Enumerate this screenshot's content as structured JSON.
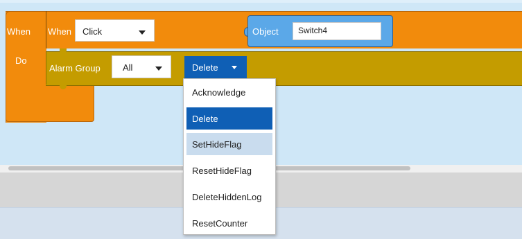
{
  "event_block": {
    "when_label": "When",
    "do_label": "Do",
    "inner_when_label": "When",
    "trigger_value": "Click",
    "object_label": "Object",
    "object_value": "Switch4",
    "color": "#f28b0c"
  },
  "statement_block": {
    "label": "Alarm Group",
    "group_value": "All",
    "action_value": "Delete",
    "color": "#c49c00"
  },
  "action_menu": {
    "items": [
      {
        "label": "Acknowledge",
        "state": "normal"
      },
      {
        "label": "Delete",
        "state": "selected"
      },
      {
        "label": "SetHideFlag",
        "state": "hover"
      },
      {
        "label": "ResetHideFlag",
        "state": "normal"
      },
      {
        "label": "DeleteHiddenLog",
        "state": "normal"
      },
      {
        "label": "ResetCounter",
        "state": "normal"
      }
    ],
    "selected_color": "#0f5fb5",
    "hover_color": "#c9dcee"
  }
}
